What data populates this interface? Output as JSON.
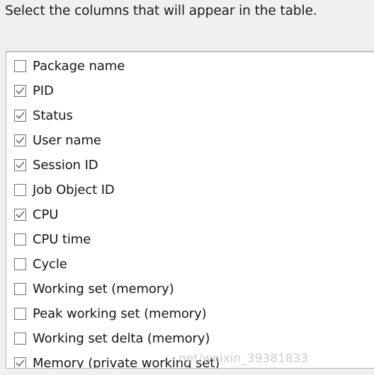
{
  "dialog": {
    "prompt": "Select the columns that will appear in the table."
  },
  "column_list": {
    "items": [
      {
        "label": "Package name",
        "checked": false
      },
      {
        "label": "PID",
        "checked": true
      },
      {
        "label": "Status",
        "checked": true
      },
      {
        "label": "User name",
        "checked": true
      },
      {
        "label": "Session ID",
        "checked": true
      },
      {
        "label": "Job Object ID",
        "checked": false
      },
      {
        "label": "CPU",
        "checked": true
      },
      {
        "label": "CPU time",
        "checked": false
      },
      {
        "label": "Cycle",
        "checked": false
      },
      {
        "label": "Working set (memory)",
        "checked": false
      },
      {
        "label": "Peak working set (memory)",
        "checked": false
      },
      {
        "label": "Working set delta (memory)",
        "checked": false
      },
      {
        "label": "Memory (private working set)",
        "checked": true
      }
    ]
  },
  "watermark": {
    "text": "net/weixin_39381833"
  },
  "colors": {
    "page_background": "#f0f0f0",
    "list_background": "#ffffff",
    "list_border": "#b4b4bb",
    "checkbox_border": "#6f6f76",
    "checkmark": "#6f6f76",
    "text": "#161616",
    "watermark": "#c9ced6"
  }
}
